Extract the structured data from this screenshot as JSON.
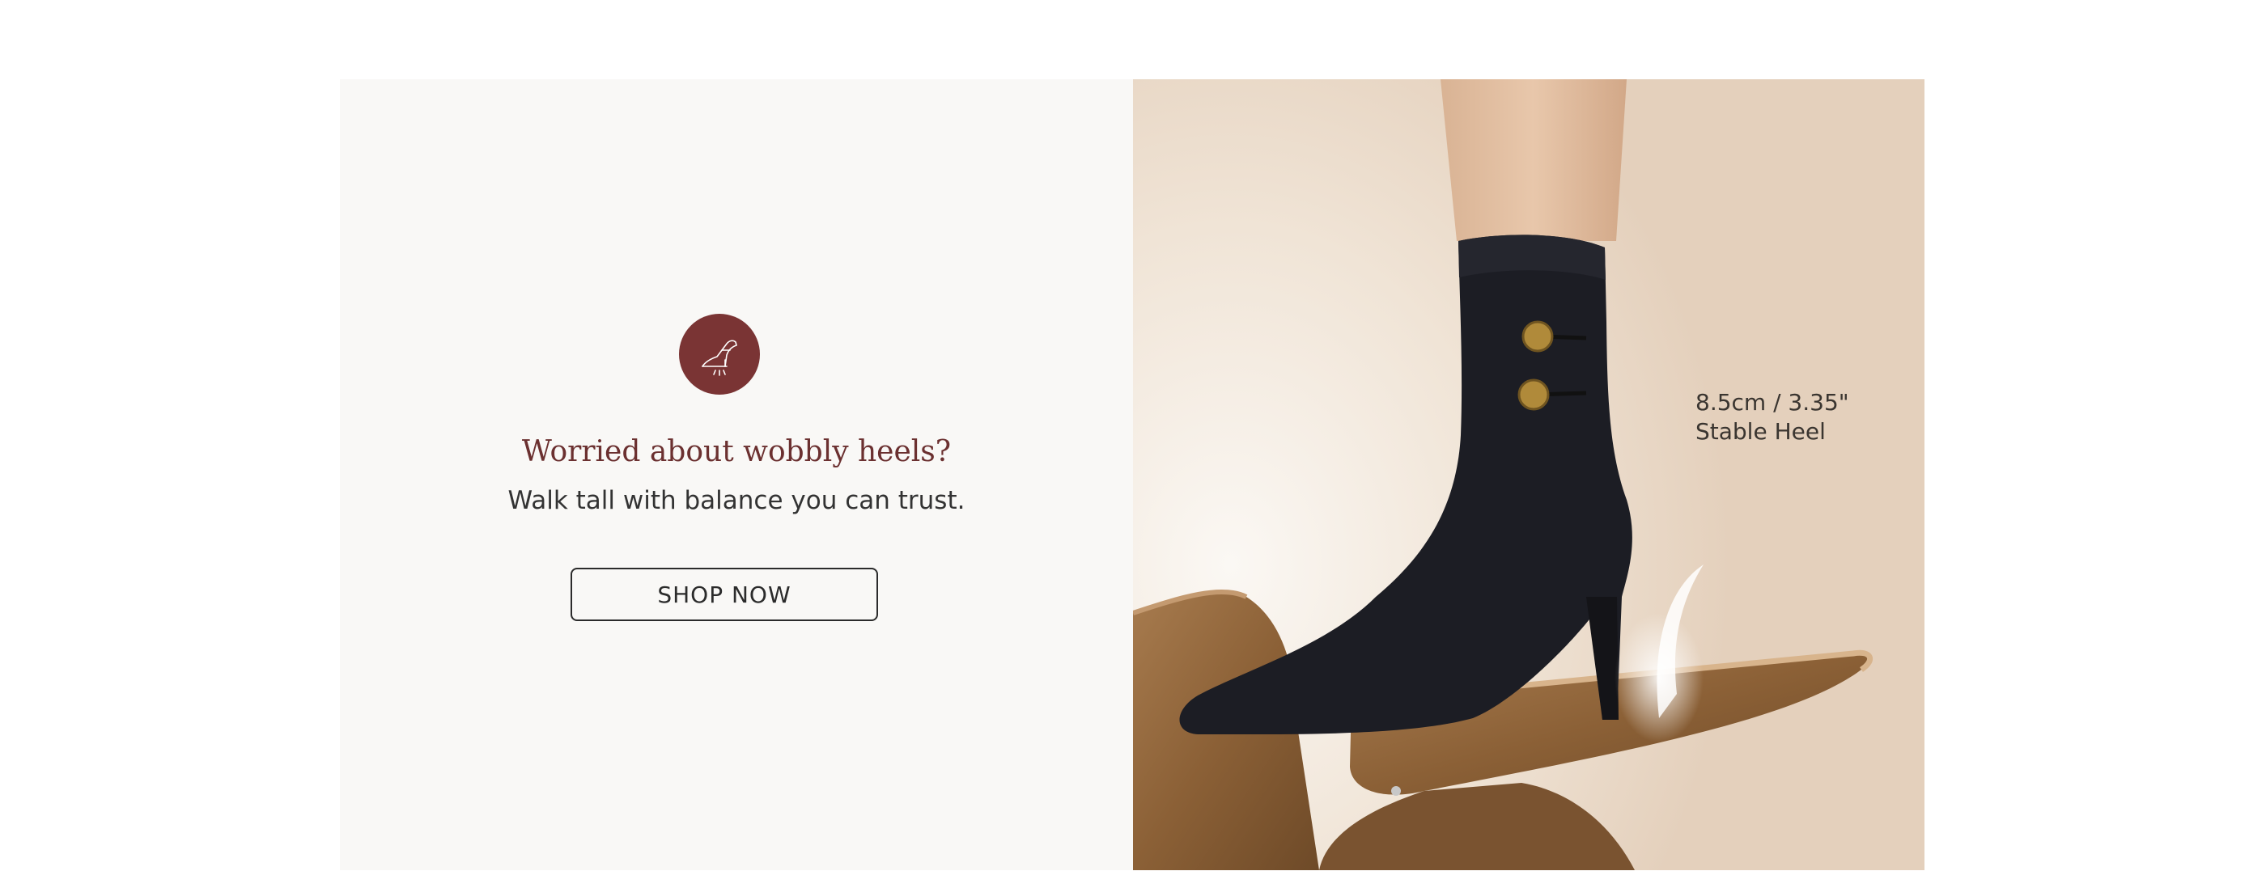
{
  "promo": {
    "icon": "heel-icon",
    "headline": "Worried about wobbly heels?",
    "subline": "Walk tall with balance you can trust.",
    "cta_label": "SHOP NOW"
  },
  "product_image": {
    "callout_height": "8.5cm / 3.35\"",
    "callout_feature": "Stable Heel"
  },
  "colors": {
    "accent": "#7a3434",
    "panel_bg": "#f9f8f6",
    "text_dark": "#2b2b2b"
  }
}
